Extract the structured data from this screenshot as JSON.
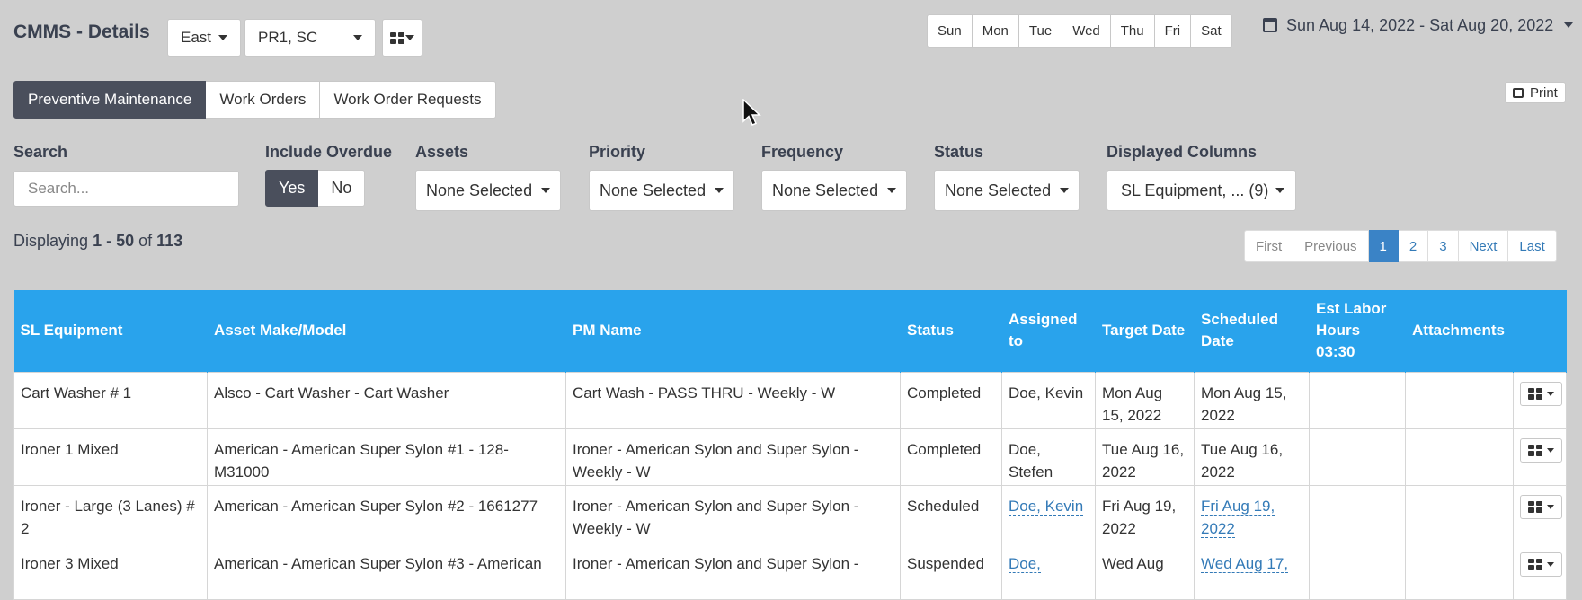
{
  "header": {
    "title": "CMMS - Details",
    "region": "East",
    "site": "PR1, SC",
    "days": [
      "Sun",
      "Mon",
      "Tue",
      "Wed",
      "Thu",
      "Fri",
      "Sat"
    ],
    "date_range": "Sun Aug 14, 2022 - Sat Aug 20, 2022"
  },
  "tabs": [
    {
      "label": "Preventive Maintenance",
      "active": true
    },
    {
      "label": "Work Orders",
      "active": false
    },
    {
      "label": "Work Order Requests",
      "active": false
    }
  ],
  "print_label": "Print",
  "filters": {
    "search_label": "Search",
    "search_placeholder": "Search...",
    "overdue_label": "Include Overdue",
    "overdue_yes": "Yes",
    "overdue_no": "No",
    "assets_label": "Assets",
    "assets_value": "None Selected",
    "priority_label": "Priority",
    "priority_value": "None Selected",
    "frequency_label": "Frequency",
    "frequency_value": "None Selected",
    "status_label": "Status",
    "status_value": "None Selected",
    "columns_label": "Displayed Columns",
    "columns_value": "SL Equipment, ... (9)"
  },
  "display": {
    "prefix": "Displaying",
    "range": "1 - 50",
    "of": "of",
    "total": "113"
  },
  "pagination": [
    "First",
    "Previous",
    "1",
    "2",
    "3",
    "Next",
    "Last"
  ],
  "table": {
    "headers": {
      "sl_equipment": "SL Equipment",
      "make_model": "Asset Make/Model",
      "pm_name": "PM Name",
      "status": "Status",
      "assigned": "Assigned to",
      "target": "Target Date",
      "scheduled": "Scheduled Date",
      "labor": "Est Labor Hours",
      "labor_total": "03:30",
      "attachments": "Attachments"
    },
    "rows": [
      {
        "equipment": "Cart Washer # 1",
        "model": "Alsco - Cart Washer - Cart Washer",
        "pm": "Cart Wash - PASS THRU - Weekly - W",
        "status": "Completed",
        "assigned": "Doe, Kevin",
        "target": "Mon Aug 15, 2022",
        "scheduled": "Mon Aug 15, 2022",
        "linked": false
      },
      {
        "equipment": "Ironer 1 Mixed",
        "model": "American - American Super Sylon #1 - 128-M31000",
        "pm": "Ironer - American Sylon and Super Sylon - Weekly - W",
        "status": "Completed",
        "assigned": "Doe, Stefen",
        "target": "Tue Aug 16, 2022",
        "scheduled": "Tue Aug 16, 2022",
        "linked": false
      },
      {
        "equipment": "Ironer - Large (3 Lanes) # 2",
        "model": "American - American Super Sylon #2 - 1661277",
        "pm": "Ironer - American Sylon and Super Sylon - Weekly - W",
        "status": "Scheduled",
        "assigned": "Doe, Kevin",
        "target": "Fri Aug 19, 2022",
        "scheduled": "Fri Aug 19, 2022",
        "linked": true
      },
      {
        "equipment": "Ironer 3 Mixed",
        "model": "American - American Super Sylon #3 - American",
        "pm": "Ironer - American Sylon and Super Sylon -",
        "status": "Suspended",
        "assigned": "Doe,",
        "target": "Wed Aug",
        "scheduled": "Wed Aug 17,",
        "linked": true
      }
    ]
  }
}
